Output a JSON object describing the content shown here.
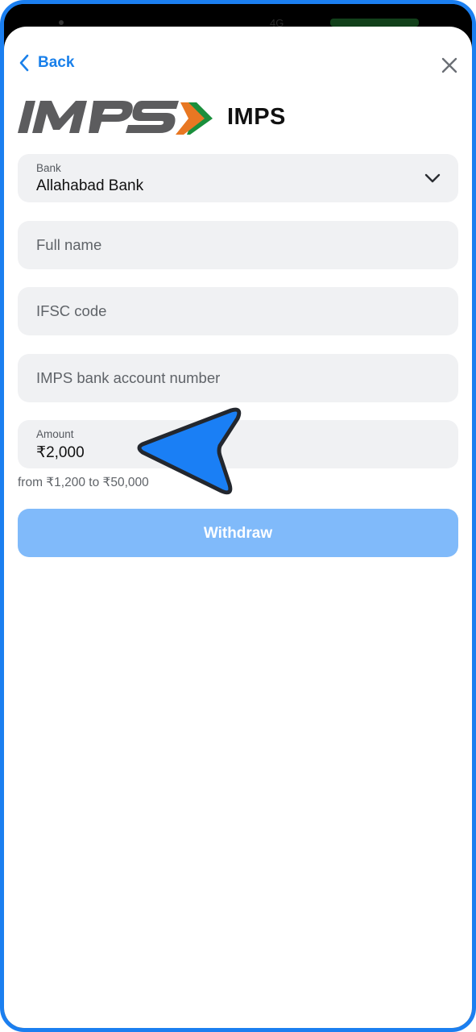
{
  "status_bar": {
    "network": "4G"
  },
  "nav": {
    "back_label": "Back"
  },
  "header": {
    "title": "IMPS"
  },
  "form": {
    "bank": {
      "label": "Bank",
      "value": "Allahabad Bank"
    },
    "full_name": {
      "placeholder": "Full name"
    },
    "ifsc": {
      "placeholder": "IFSC code"
    },
    "account": {
      "placeholder": "IMPS bank account number"
    },
    "amount": {
      "label": "Amount",
      "value": "₹2,000",
      "hint": "from ₹1,200 to ₹50,000"
    },
    "submit_label": "Withdraw"
  },
  "colors": {
    "accent": "#1a80ea",
    "button_disabled": "#80bafa",
    "field_bg": "#f0f1f3",
    "logo_orange": "#e87722",
    "logo_green": "#1a8f3c"
  },
  "icons": [
    "chevron-left-icon",
    "close-icon",
    "chevron-down-icon",
    "imps-logo",
    "pointer-cursor-icon"
  ]
}
